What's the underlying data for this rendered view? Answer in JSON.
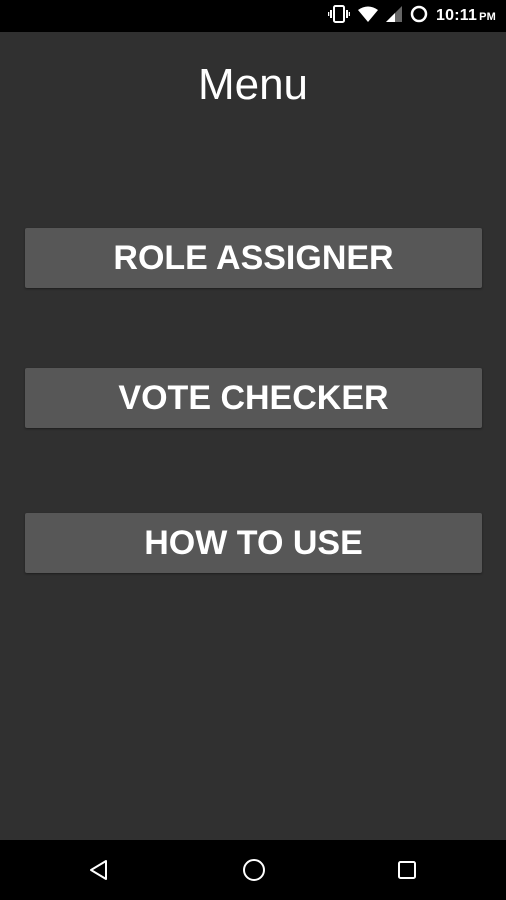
{
  "status_bar": {
    "time": "10:11",
    "ampm": "PM",
    "icons": [
      "vibrate-icon",
      "wifi-icon",
      "signal-icon",
      "sync-icon"
    ]
  },
  "screen": {
    "title": "Menu",
    "buttons": [
      {
        "label": "ROLE ASSIGNER"
      },
      {
        "label": "VOTE CHECKER"
      },
      {
        "label": "HOW TO USE"
      }
    ]
  },
  "nav_bar": {
    "icons": [
      "back-icon",
      "home-icon",
      "recents-icon"
    ]
  },
  "colors": {
    "background": "#303030",
    "button": "#575757",
    "bars": "#000000",
    "text": "#ffffff"
  }
}
